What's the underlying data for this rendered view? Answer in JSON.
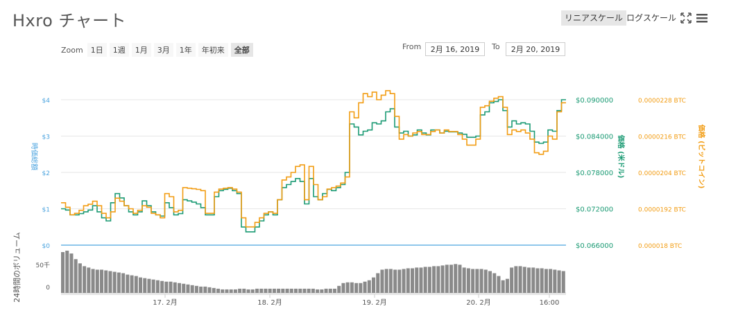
{
  "title": "Hxro チャート",
  "controls": {
    "linear_label": "リニアスケール",
    "log_label": "ログスケール",
    "expand_icon": "expand-icon",
    "menu_icon": "menu-icon"
  },
  "zoom": {
    "label": "Zoom",
    "options": [
      "1日",
      "1週",
      "1月",
      "3月",
      "1年",
      "年初来",
      "全部"
    ],
    "selected": "全部"
  },
  "range": {
    "from_label": "From",
    "from_value": "2月 16, 2019",
    "to_label": "To",
    "to_value": "2月 20, 2019"
  },
  "colors": {
    "usd": "#1a9a73",
    "btc": "#f29c12",
    "cap_axis": "#4aa3df",
    "volume": "#8a8a8a",
    "grid": "#e6e6e6"
  },
  "chart_data": {
    "type": "line",
    "x": [
      "17. 2月",
      "18. 2月",
      "19. 2月",
      "20. 2月",
      "16:00"
    ],
    "axes": {
      "cap": {
        "title": "時価総額",
        "ticks": [
          "$4",
          "$3",
          "$2",
          "$1",
          "$0"
        ]
      },
      "usd": {
        "title": "価格 (米ドル)",
        "ticks": [
          "$0.090000",
          "$0.084000",
          "$0.078000",
          "$0.072000",
          "$0.066000"
        ],
        "ylim": [
          0.066,
          0.09
        ]
      },
      "btc": {
        "title": "価格 (ビットコイン)",
        "ticks": [
          "0.0000228 BTC",
          "0.0000216 BTC",
          "0.0000204 BTC",
          "0.0000192 BTC",
          "0.000018 BTC"
        ],
        "ylim": [
          1.8e-05,
          2.28e-05
        ]
      },
      "volume": {
        "title": "24時間のボリューム",
        "ticks": [
          "50千",
          "0"
        ]
      }
    },
    "series": [
      {
        "name": "価格 (米ドル)",
        "axis": "usd",
        "values": [
          0.072,
          0.0718,
          0.071,
          0.071,
          0.0712,
          0.0715,
          0.0718,
          0.0725,
          0.0715,
          0.0705,
          0.07,
          0.073,
          0.0745,
          0.0738,
          0.0725,
          0.0715,
          0.071,
          0.0715,
          0.0733,
          0.0725,
          0.0715,
          0.071,
          0.0708,
          0.073,
          0.0722,
          0.071,
          0.0712,
          0.0735,
          0.0733,
          0.0731,
          0.0728,
          0.0722,
          0.071,
          0.071,
          0.074,
          0.075,
          0.0752,
          0.0754,
          0.075,
          0.0745,
          0.069,
          0.0682,
          0.0682,
          0.069,
          0.07,
          0.071,
          0.0715,
          0.071,
          0.0735,
          0.0755,
          0.076,
          0.0765,
          0.077,
          0.0765,
          0.0728,
          0.077,
          0.074,
          0.0735,
          0.0745,
          0.0752,
          0.075,
          0.0755,
          0.076,
          0.078,
          0.086,
          0.0855,
          0.0842,
          0.0848,
          0.085,
          0.0862,
          0.086,
          0.0865,
          0.088,
          0.0885,
          0.0855,
          0.0845,
          0.0848,
          0.084,
          0.0842,
          0.085,
          0.0845,
          0.0842,
          0.085,
          0.085,
          0.0845,
          0.0848,
          0.0847,
          0.0847,
          0.0845,
          0.0843,
          0.0838,
          0.0838,
          0.084,
          0.0875,
          0.088,
          0.0895,
          0.0897,
          0.09,
          0.0882,
          0.0855,
          0.0865,
          0.086,
          0.0862,
          0.086,
          0.0848,
          0.083,
          0.0828,
          0.083,
          0.085,
          0.0848,
          0.0882,
          0.09
        ]
      },
      {
        "name": "価格 (ビットコイン)",
        "axis": "btc",
        "values": [
          1.94e-05,
          1.925e-05,
          1.9e-05,
          1.905e-05,
          1.915e-05,
          1.93e-05,
          1.935e-05,
          1.945e-05,
          1.93e-05,
          1.905e-05,
          1.89e-05,
          1.91e-05,
          1.955e-05,
          1.945e-05,
          1.93e-05,
          1.92e-05,
          1.905e-05,
          1.915e-05,
          1.93e-05,
          1.925e-05,
          1.905e-05,
          1.9e-05,
          1.89e-05,
          1.97e-05,
          1.96e-05,
          1.91e-05,
          1.915e-05,
          1.99e-05,
          1.988e-05,
          1.986e-05,
          1.984e-05,
          1.98e-05,
          1.905e-05,
          1.905e-05,
          1.975e-05,
          1.985e-05,
          1.988e-05,
          1.99e-05,
          1.985e-05,
          1.975e-05,
          1.89e-05,
          1.86e-05,
          1.86e-05,
          1.875e-05,
          1.89e-05,
          1.905e-05,
          1.91e-05,
          1.905e-05,
          1.95e-05,
          2.015e-05,
          2.025e-05,
          2.04e-05,
          2.06e-05,
          2.065e-05,
          1.95e-05,
          2.06e-05,
          2e-05,
          1.95e-05,
          1.96e-05,
          1.985e-05,
          1.99e-05,
          1.995e-05,
          2.005e-05,
          2.025e-05,
          2.24e-05,
          2.22e-05,
          2.27e-05,
          2.3e-05,
          2.29e-05,
          2.305e-05,
          2.28e-05,
          2.295e-05,
          2.31e-05,
          2.3e-05,
          2.225e-05,
          2.15e-05,
          2.165e-05,
          2.16e-05,
          2.17e-05,
          2.175e-05,
          2.165e-05,
          2.165e-05,
          2.175e-05,
          2.18e-05,
          2.17e-05,
          2.18e-05,
          2.175e-05,
          2.175e-05,
          2.165e-05,
          2.15e-05,
          2.13e-05,
          2.13e-05,
          2.15e-05,
          2.255e-05,
          2.26e-05,
          2.275e-05,
          2.285e-05,
          2.29e-05,
          2.255e-05,
          2.165e-05,
          2.18e-05,
          2.175e-05,
          2.18e-05,
          2.17e-05,
          2.15e-05,
          2.105e-05,
          2.1e-05,
          2.11e-05,
          2.16e-05,
          2.15e-05,
          2.24e-05,
          2.27e-05
        ]
      },
      {
        "name": "24時間のボリューム",
        "axis": "volume",
        "values": [
          58,
          60,
          56,
          48,
          42,
          38,
          36,
          34,
          33,
          33,
          32,
          31,
          30,
          29,
          28,
          26,
          25,
          24,
          22,
          21,
          20,
          19,
          18,
          17,
          16,
          16,
          15,
          14,
          13,
          12,
          11,
          10,
          9,
          9,
          8,
          7,
          6,
          5,
          5,
          5,
          5,
          6,
          6,
          5,
          5,
          6,
          6,
          6,
          6,
          6,
          6,
          6,
          6,
          6,
          6,
          6,
          6,
          6,
          6,
          5,
          5,
          6,
          6,
          6,
          10,
          14,
          15,
          15,
          14,
          14,
          16,
          18,
          22,
          28,
          33,
          34,
          34,
          33,
          33,
          34,
          35,
          35,
          36,
          36,
          37,
          37,
          38,
          38,
          39,
          40,
          40,
          41,
          40,
          36,
          35,
          34,
          34,
          34,
          33,
          31,
          28,
          24,
          18,
          20,
          36,
          38,
          38,
          37,
          36,
          36,
          35,
          35,
          34,
          34,
          33,
          32,
          31
        ]
      }
    ],
    "grid": true,
    "legend": "none"
  }
}
